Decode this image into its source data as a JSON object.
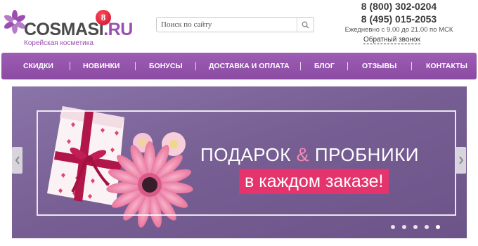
{
  "logo": {
    "text_main": "COSMASI",
    "text_tld": ".RU",
    "badge": "8",
    "tagline": "Корейская косметика",
    "flower_icon": "flower-icon"
  },
  "search": {
    "placeholder": "Поиск по сайту",
    "icon": "search-icon"
  },
  "contacts": {
    "phone1": "8 (800) 302-0204",
    "phone2": "8 (495) 015-2053",
    "hours": "Ежедневно с 9.00 до 21.00 по МСК",
    "callback": "Обратный звонок"
  },
  "nav": {
    "items": [
      {
        "label": "СКИДКИ"
      },
      {
        "label": "НОВИНКИ"
      },
      {
        "label": "БОНУСЫ"
      },
      {
        "label": "ДОСТАВКА И ОПЛАТА"
      },
      {
        "label": "БЛОГ"
      },
      {
        "label": "ОТЗЫВЫ"
      },
      {
        "label": "КОНТАКТЫ"
      }
    ]
  },
  "banner": {
    "headline_part1": "ПОДАРОК",
    "headline_amp": "&",
    "headline_part2": "ПРОБНИКИ",
    "subline": "в каждом заказе!",
    "slide_count": 5,
    "active_slide": 5
  },
  "colors": {
    "brand_purple": "#9a4fb0",
    "nav_bg": "#9e5db4",
    "banner_bg": "#7a6296",
    "accent_pink": "#e5336d",
    "badge_red": "#c8102e"
  }
}
